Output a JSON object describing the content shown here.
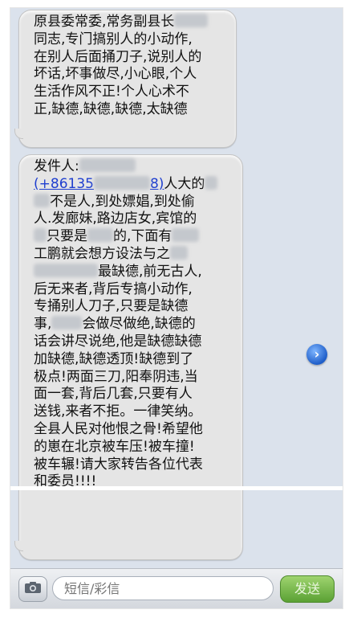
{
  "messages": [
    {
      "lines": [
        "原县委常委,常务副县长",
        "同志,专门搞别人的小动作,",
        "在别人后面捅刀子,说别人的",
        "坏话,坏事做尽,小心眼,个人",
        "生活作风不正!个人心术不",
        "正,缺德,缺德,缺德,太缺德"
      ]
    },
    {
      "sender_label": "发件人:",
      "phone_prefix": "(+86135",
      "phone_suffix": "8)",
      "lines": [
        "人大的",
        "不是人,到处嫖娼,到处偷",
        "人.发廊妹,路边店女,宾馆的",
        "只要是",
        "的,下面有",
        "工鹏就会想方设法与之",
        "最缺德,前无古人,",
        "后无来者,背后专搞小动作,",
        "专捅别人刀子,只要是缺德",
        "事,",
        "会做尽做绝,缺德的",
        "话会讲尽说绝,他是缺德缺德",
        "加缺德,缺德透顶!缺德到了",
        "极点!两面三刀,阳奉阴违,当",
        "面一套,背后几套,只要有人",
        "送钱,来者不拒。一律笑纳。",
        "全县人民对他恨之骨!希望他",
        "的崽在北京被车压!被车撞!",
        "被车辗!请大家转告各位代表",
        "和委员!!!!"
      ]
    }
  ],
  "input": {
    "placeholder": "短信/彩信",
    "send_label": "发送"
  },
  "icons": {
    "camera": "camera-icon",
    "forward": "forward-arrow-icon"
  },
  "colors": {
    "background": "#dbe2ec",
    "bubble": "#e5e5e5",
    "link": "#1f3fcf",
    "send_button": "#5aa134"
  }
}
